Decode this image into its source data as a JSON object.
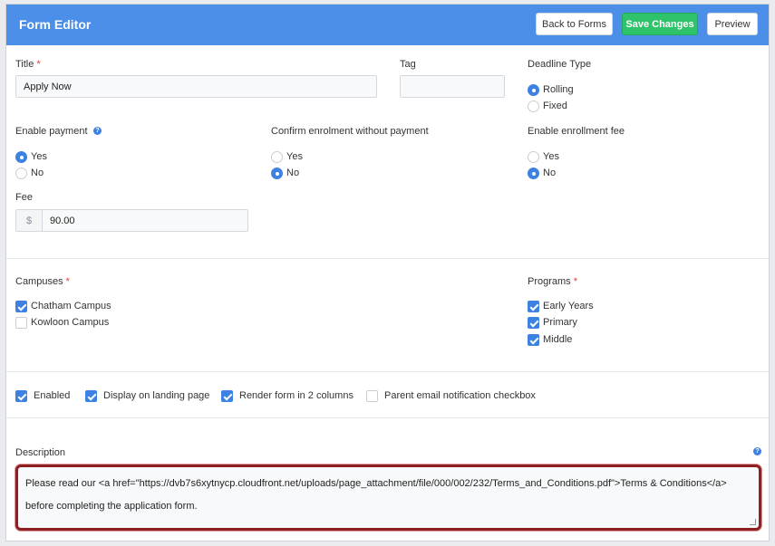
{
  "header": {
    "title": "Form Editor",
    "back_label": "Back to Forms",
    "save_label": "Save Changes",
    "preview_label": "Preview"
  },
  "title_field": {
    "label": "Title",
    "required_mark": "*",
    "value": "Apply Now"
  },
  "tag_field": {
    "label": "Tag",
    "value": ""
  },
  "deadline": {
    "label": "Deadline Type",
    "options": [
      "Rolling",
      "Fixed"
    ],
    "selected": "Rolling"
  },
  "enable_payment": {
    "label": "Enable payment",
    "help": "?",
    "options": [
      "Yes",
      "No"
    ],
    "selected": "Yes"
  },
  "confirm_enrolment": {
    "label": "Confirm enrolment without payment",
    "options": [
      "Yes",
      "No"
    ],
    "selected": "No"
  },
  "enrollment_fee": {
    "label": "Enable enrollment fee",
    "options": [
      "Yes",
      "No"
    ],
    "selected": "No"
  },
  "fee": {
    "label": "Fee",
    "prefix": "$",
    "value": "90.00"
  },
  "campuses": {
    "label": "Campuses",
    "required_mark": "*",
    "items": [
      {
        "label": "Chatham Campus",
        "checked": true
      },
      {
        "label": "Kowloon Campus",
        "checked": false
      }
    ]
  },
  "programs": {
    "label": "Programs",
    "required_mark": "*",
    "items": [
      {
        "label": "Early Years",
        "checked": true
      },
      {
        "label": "Primary",
        "checked": true
      },
      {
        "label": "Middle",
        "checked": true
      }
    ]
  },
  "options": [
    {
      "label": "Enabled",
      "checked": true
    },
    {
      "label": "Display on landing page",
      "checked": true
    },
    {
      "label": "Render form in 2 columns",
      "checked": true
    },
    {
      "label": "Parent email notification checkbox",
      "checked": false
    }
  ],
  "description": {
    "label": "Description",
    "help": "?",
    "value": "Please read our <a href=\"https://dvb7s6xytnycp.cloudfront.net/uploads/page_attachment/file/000/002/232/Terms_and_Conditions.pdf\">Terms & Conditions</a> before completing the application form."
  },
  "colors": {
    "header": "#4b8fe8",
    "save": "#2ec26a",
    "accent": "#3d82e3",
    "highlight": "#8f1f23"
  }
}
